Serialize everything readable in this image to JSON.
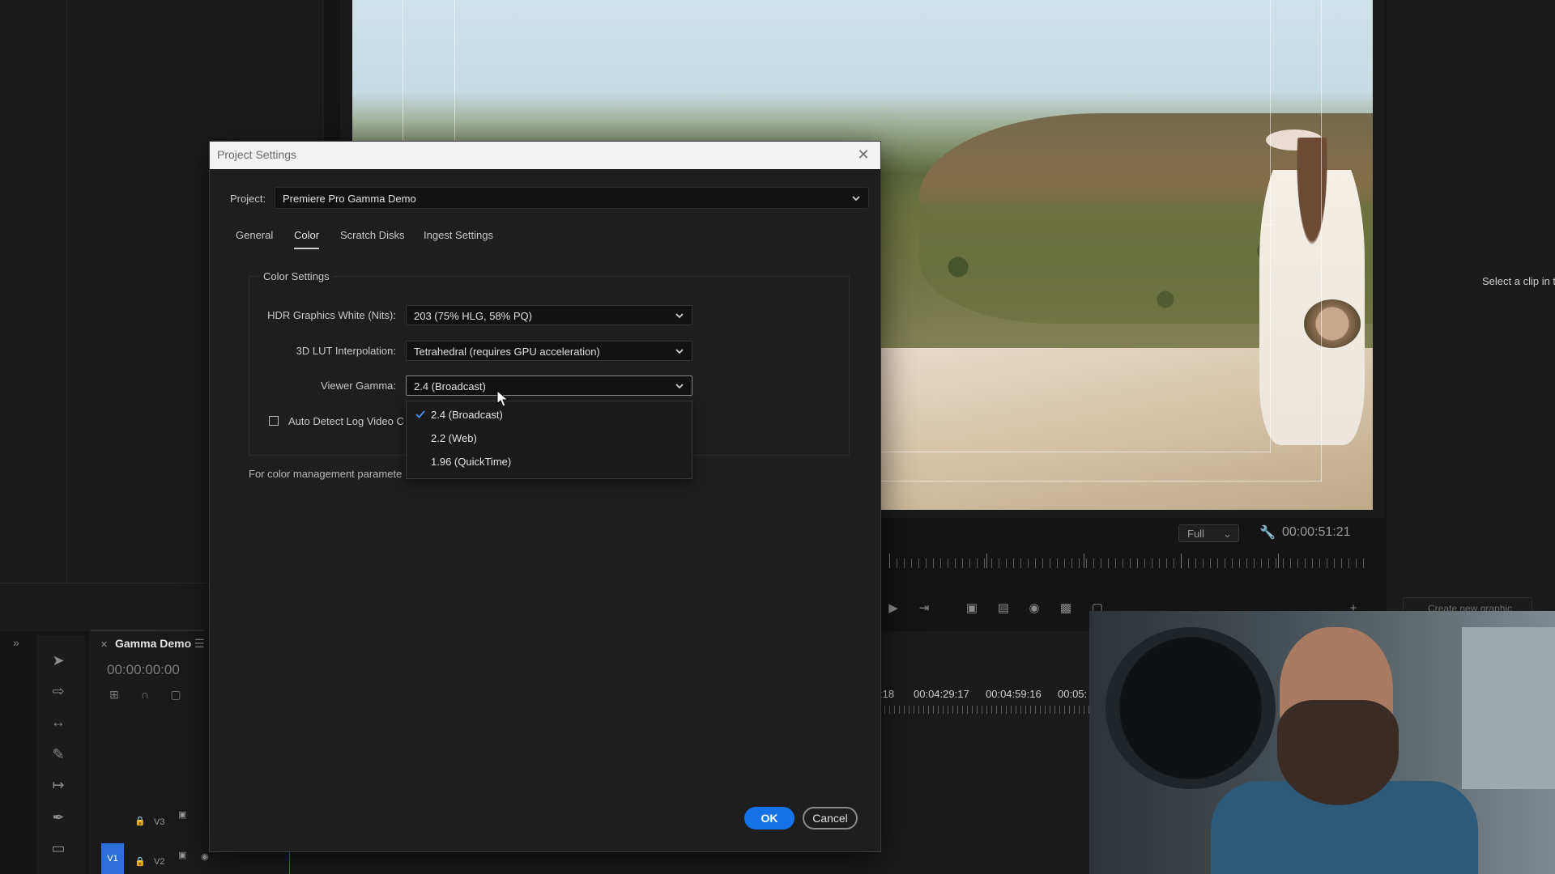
{
  "dialog": {
    "title": "Project Settings",
    "project_label": "Project:",
    "project_value": "Premiere Pro Gamma Demo",
    "tabs": [
      {
        "label": "General",
        "active": false
      },
      {
        "label": "Color",
        "active": true
      },
      {
        "label": "Scratch Disks",
        "active": false
      },
      {
        "label": "Ingest Settings",
        "active": false
      }
    ],
    "color_settings": {
      "group_title": "Color Settings",
      "hdr_white_label": "HDR Graphics White (Nits):",
      "hdr_white_value": "203 (75% HLG, 58% PQ)",
      "lut_label": "3D LUT Interpolation:",
      "lut_value": "Tetrahedral (requires GPU acceleration)",
      "gamma_label": "Viewer Gamma:",
      "gamma_value": "2.4 (Broadcast)",
      "gamma_options": [
        "2.4 (Broadcast)",
        "2.2 (Web)",
        "1.96 (QuickTime)"
      ],
      "gamma_selected_index": 0,
      "autodetect_label": "Auto Detect Log Video C",
      "autodetect_checked": false
    },
    "footer_note": "For color management paramete",
    "ok_label": "OK",
    "cancel_label": "Cancel"
  },
  "viewer": {
    "zoom": "Full",
    "timecode": "00:00:51:21"
  },
  "right_panel": {
    "hint": "Select a clip in t",
    "create_graphic_label": "Create new graphic"
  },
  "timeline": {
    "sequence_name": "Gamma Demo",
    "timecode": "00:00:00:00",
    "ruler_times": [
      ":18",
      "00:04:29:17",
      "00:04:59:16",
      "00:05:"
    ],
    "tracks": {
      "v3": "V3",
      "v2": "V2",
      "v1_target": "V1"
    }
  },
  "colors": {
    "accent": "#1473e6",
    "dialog_bg": "#1e1e1e",
    "titlebar_bg": "#f2f2f2",
    "app_bg": "#141414"
  },
  "icons": [
    "close-icon",
    "chevron-down-icon",
    "checkmark-icon",
    "cursor-arrow-icon",
    "wrench-icon",
    "selection-tool-icon",
    "razor-tool-icon",
    "pen-tool-icon",
    "lock-icon",
    "eye-icon",
    "camera-icon"
  ]
}
